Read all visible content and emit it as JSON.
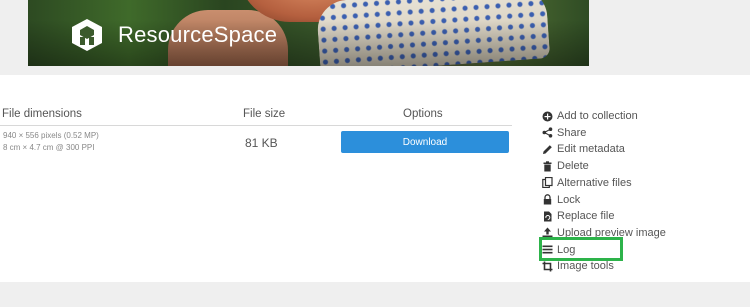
{
  "brand": {
    "name_bold": "Resource",
    "name_light": "Space"
  },
  "file_table": {
    "headers": {
      "dimensions": "File dimensions",
      "size": "File size",
      "options": "Options"
    },
    "row": {
      "pixels": "940 × 556 pixels (0.52 MP)",
      "print_size": "8 cm × 4.7 cm @ 300 PPI",
      "size": "81 KB",
      "download_label": "Download"
    }
  },
  "actions": [
    {
      "label": "Add to collection",
      "icon": "plus-circle-icon"
    },
    {
      "label": "Share",
      "icon": "share-icon"
    },
    {
      "label": "Edit metadata",
      "icon": "pencil-icon"
    },
    {
      "label": "Delete",
      "icon": "trash-icon"
    },
    {
      "label": "Alternative files",
      "icon": "files-icon"
    },
    {
      "label": "Lock",
      "icon": "lock-icon"
    },
    {
      "label": "Replace file",
      "icon": "replace-file-icon"
    },
    {
      "label": "Upload preview image",
      "icon": "upload-icon"
    },
    {
      "label": "Log",
      "icon": "list-icon"
    },
    {
      "label": "Image tools",
      "icon": "crop-icon"
    }
  ],
  "colors": {
    "download_button": "#2c8fdb",
    "highlight_box": "#2db34a"
  }
}
